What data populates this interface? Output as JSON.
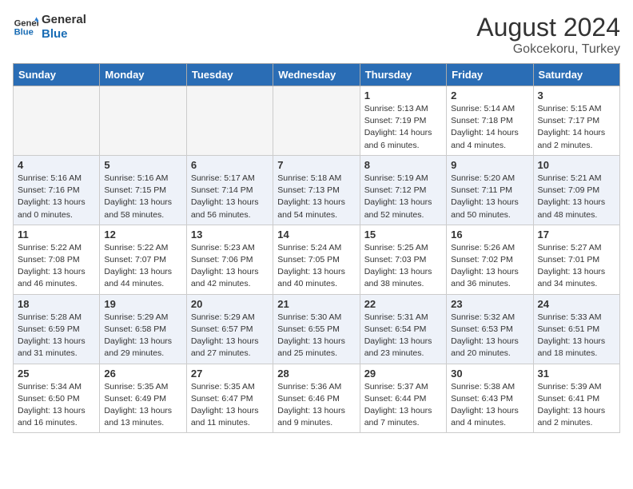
{
  "header": {
    "logo_line1": "General",
    "logo_line2": "Blue",
    "month_year": "August 2024",
    "location": "Gokcekoru, Turkey"
  },
  "days_of_week": [
    "Sunday",
    "Monday",
    "Tuesday",
    "Wednesday",
    "Thursday",
    "Friday",
    "Saturday"
  ],
  "weeks": [
    [
      {
        "day": "",
        "empty": true
      },
      {
        "day": "",
        "empty": true
      },
      {
        "day": "",
        "empty": true
      },
      {
        "day": "",
        "empty": true
      },
      {
        "day": "1",
        "sunrise": "5:13 AM",
        "sunset": "7:19 PM",
        "daylight": "14 hours and 6 minutes."
      },
      {
        "day": "2",
        "sunrise": "5:14 AM",
        "sunset": "7:18 PM",
        "daylight": "14 hours and 4 minutes."
      },
      {
        "day": "3",
        "sunrise": "5:15 AM",
        "sunset": "7:17 PM",
        "daylight": "14 hours and 2 minutes."
      }
    ],
    [
      {
        "day": "4",
        "sunrise": "5:16 AM",
        "sunset": "7:16 PM",
        "daylight": "13 hours and 0 minutes."
      },
      {
        "day": "5",
        "sunrise": "5:16 AM",
        "sunset": "7:15 PM",
        "daylight": "13 hours and 58 minutes."
      },
      {
        "day": "6",
        "sunrise": "5:17 AM",
        "sunset": "7:14 PM",
        "daylight": "13 hours and 56 minutes."
      },
      {
        "day": "7",
        "sunrise": "5:18 AM",
        "sunset": "7:13 PM",
        "daylight": "13 hours and 54 minutes."
      },
      {
        "day": "8",
        "sunrise": "5:19 AM",
        "sunset": "7:12 PM",
        "daylight": "13 hours and 52 minutes."
      },
      {
        "day": "9",
        "sunrise": "5:20 AM",
        "sunset": "7:11 PM",
        "daylight": "13 hours and 50 minutes."
      },
      {
        "day": "10",
        "sunrise": "5:21 AM",
        "sunset": "7:09 PM",
        "daylight": "13 hours and 48 minutes."
      }
    ],
    [
      {
        "day": "11",
        "sunrise": "5:22 AM",
        "sunset": "7:08 PM",
        "daylight": "13 hours and 46 minutes."
      },
      {
        "day": "12",
        "sunrise": "5:22 AM",
        "sunset": "7:07 PM",
        "daylight": "13 hours and 44 minutes."
      },
      {
        "day": "13",
        "sunrise": "5:23 AM",
        "sunset": "7:06 PM",
        "daylight": "13 hours and 42 minutes."
      },
      {
        "day": "14",
        "sunrise": "5:24 AM",
        "sunset": "7:05 PM",
        "daylight": "13 hours and 40 minutes."
      },
      {
        "day": "15",
        "sunrise": "5:25 AM",
        "sunset": "7:03 PM",
        "daylight": "13 hours and 38 minutes."
      },
      {
        "day": "16",
        "sunrise": "5:26 AM",
        "sunset": "7:02 PM",
        "daylight": "13 hours and 36 minutes."
      },
      {
        "day": "17",
        "sunrise": "5:27 AM",
        "sunset": "7:01 PM",
        "daylight": "13 hours and 34 minutes."
      }
    ],
    [
      {
        "day": "18",
        "sunrise": "5:28 AM",
        "sunset": "6:59 PM",
        "daylight": "13 hours and 31 minutes."
      },
      {
        "day": "19",
        "sunrise": "5:29 AM",
        "sunset": "6:58 PM",
        "daylight": "13 hours and 29 minutes."
      },
      {
        "day": "20",
        "sunrise": "5:29 AM",
        "sunset": "6:57 PM",
        "daylight": "13 hours and 27 minutes."
      },
      {
        "day": "21",
        "sunrise": "5:30 AM",
        "sunset": "6:55 PM",
        "daylight": "13 hours and 25 minutes."
      },
      {
        "day": "22",
        "sunrise": "5:31 AM",
        "sunset": "6:54 PM",
        "daylight": "13 hours and 23 minutes."
      },
      {
        "day": "23",
        "sunrise": "5:32 AM",
        "sunset": "6:53 PM",
        "daylight": "13 hours and 20 minutes."
      },
      {
        "day": "24",
        "sunrise": "5:33 AM",
        "sunset": "6:51 PM",
        "daylight": "13 hours and 18 minutes."
      }
    ],
    [
      {
        "day": "25",
        "sunrise": "5:34 AM",
        "sunset": "6:50 PM",
        "daylight": "13 hours and 16 minutes."
      },
      {
        "day": "26",
        "sunrise": "5:35 AM",
        "sunset": "6:49 PM",
        "daylight": "13 hours and 13 minutes."
      },
      {
        "day": "27",
        "sunrise": "5:35 AM",
        "sunset": "6:47 PM",
        "daylight": "13 hours and 11 minutes."
      },
      {
        "day": "28",
        "sunrise": "5:36 AM",
        "sunset": "6:46 PM",
        "daylight": "13 hours and 9 minutes."
      },
      {
        "day": "29",
        "sunrise": "5:37 AM",
        "sunset": "6:44 PM",
        "daylight": "13 hours and 7 minutes."
      },
      {
        "day": "30",
        "sunrise": "5:38 AM",
        "sunset": "6:43 PM",
        "daylight": "13 hours and 4 minutes."
      },
      {
        "day": "31",
        "sunrise": "5:39 AM",
        "sunset": "6:41 PM",
        "daylight": "13 hours and 2 minutes."
      }
    ]
  ]
}
